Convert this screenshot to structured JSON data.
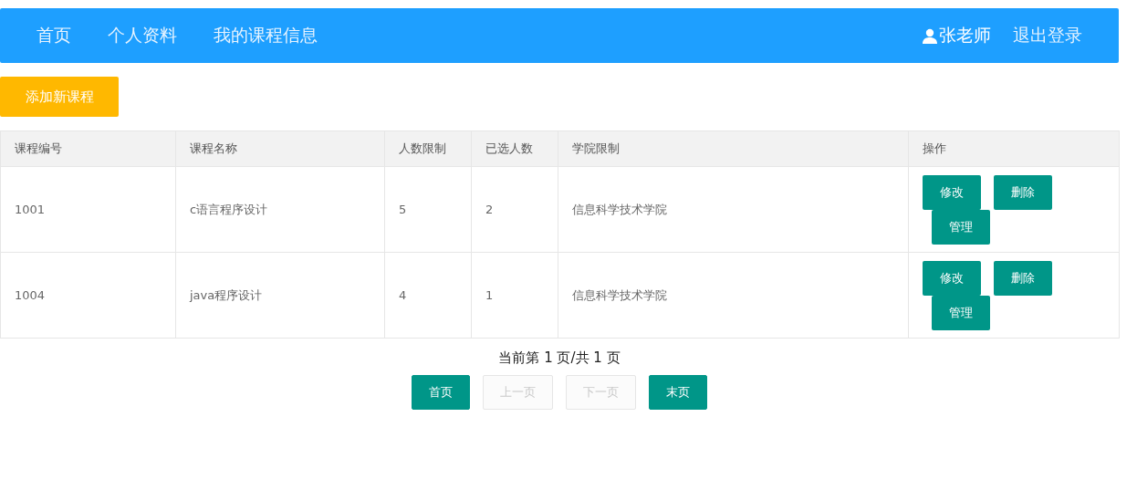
{
  "navbar": {
    "links": [
      "首页",
      "个人资料",
      "我的课程信息"
    ],
    "user": "张老师",
    "logout": "退出登录"
  },
  "add_button": "添加新课程",
  "table": {
    "columns": [
      "课程编号",
      "课程名称",
      "人数限制",
      "已选人数",
      "学院限制",
      "操作"
    ],
    "rows": [
      {
        "cells": [
          "1001",
          "c语言程序设计",
          "5",
          "2",
          "信息科学技术学院"
        ],
        "actions": [
          "修改",
          "删除",
          "管理"
        ]
      },
      {
        "cells": [
          "1004",
          "java程序设计",
          "4",
          "1",
          "信息科学技术学院"
        ],
        "actions": [
          "修改",
          "删除",
          "管理"
        ]
      }
    ]
  },
  "pagination": {
    "info": "当前第 1 页/共 1 页",
    "buttons": [
      {
        "label": "首页",
        "disabled": false
      },
      {
        "label": "上一页",
        "disabled": true
      },
      {
        "label": "下一页",
        "disabled": true
      },
      {
        "label": "末页",
        "disabled": false
      }
    ]
  }
}
